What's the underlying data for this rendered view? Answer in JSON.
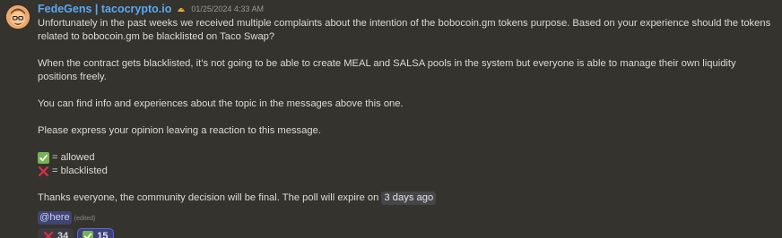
{
  "message": {
    "username": "FedeGens | tacocrypto.io",
    "role_icon": "taco-icon",
    "timestamp": "01/25/2024 4:33 AM",
    "paragraph1": "Unfortunately in the past weeks we received multiple complaints about the intention of the bobocoin.gm tokens purpose. Based on your experience should the tokens related to bobocoin.gm be blacklisted on Taco Swap?",
    "paragraph2": "When the contract gets blacklisted, it’s not going to be able to create MEAL and SALSA pools in the system but everyone is able to manage their own liquidity positions freely.",
    "paragraph3": "You can find info and experiences about the topic in the messages above this one.",
    "paragraph4": "Please express your opinion leaving a reaction to this message.",
    "option_allowed": " = allowed",
    "option_blacklisted": " = blacklisted",
    "closing_text": "Thanks everyone, the community decision will be final. The poll will expire on ",
    "expiry": "3 days ago",
    "mention": "@here",
    "edited": "(edited)"
  },
  "reactions": [
    {
      "emoji": "cross-mark-icon",
      "count": "34",
      "active": false
    },
    {
      "emoji": "check-mark-icon",
      "count": "15",
      "active": true
    }
  ],
  "colors": {
    "background": "#34332e",
    "username": "#5aa9f0",
    "mention_bg": "#3f4470",
    "check_green": "#77b255",
    "cross_red": "#dd2e44"
  }
}
